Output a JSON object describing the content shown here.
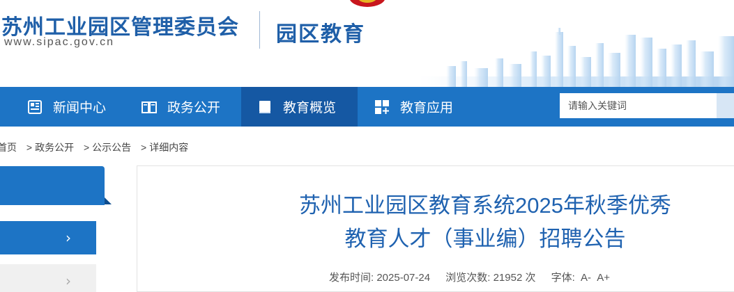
{
  "header": {
    "site_name": "苏州工业园区管理委员会",
    "site_url": "www.sipac.gov.cn",
    "section_name": "园区教育"
  },
  "nav": {
    "items": [
      {
        "label": "新闻中心",
        "icon": "newspaper-icon"
      },
      {
        "label": "政务公开",
        "icon": "open-book-icon"
      },
      {
        "label": "教育概览",
        "icon": "book-icon",
        "active": true
      },
      {
        "label": "教育应用",
        "icon": "apps-grid-icon"
      }
    ],
    "search_placeholder": "请输入关键词"
  },
  "breadcrumb": {
    "home": "首页",
    "sep": ">",
    "level1": "政务公开",
    "level2": "公示公告",
    "level3": "详细内容"
  },
  "sidebar": {
    "chevron": "›"
  },
  "article": {
    "title_line1": "苏州工业园区教育系统2025年秋季优秀",
    "title_line2": "教育人才（事业编）招聘公告",
    "publish_label": "发布时间:",
    "publish_date": "2025-07-24",
    "views_label": "浏览次数:",
    "views_count": "21952",
    "views_unit": "次",
    "font_label": "字体:",
    "font_smaller": "A-",
    "font_larger": "A+"
  },
  "colors": {
    "brand_blue": "#1d74c5",
    "nav_active": "#1558a3",
    "title_blue": "#1f62b0"
  }
}
